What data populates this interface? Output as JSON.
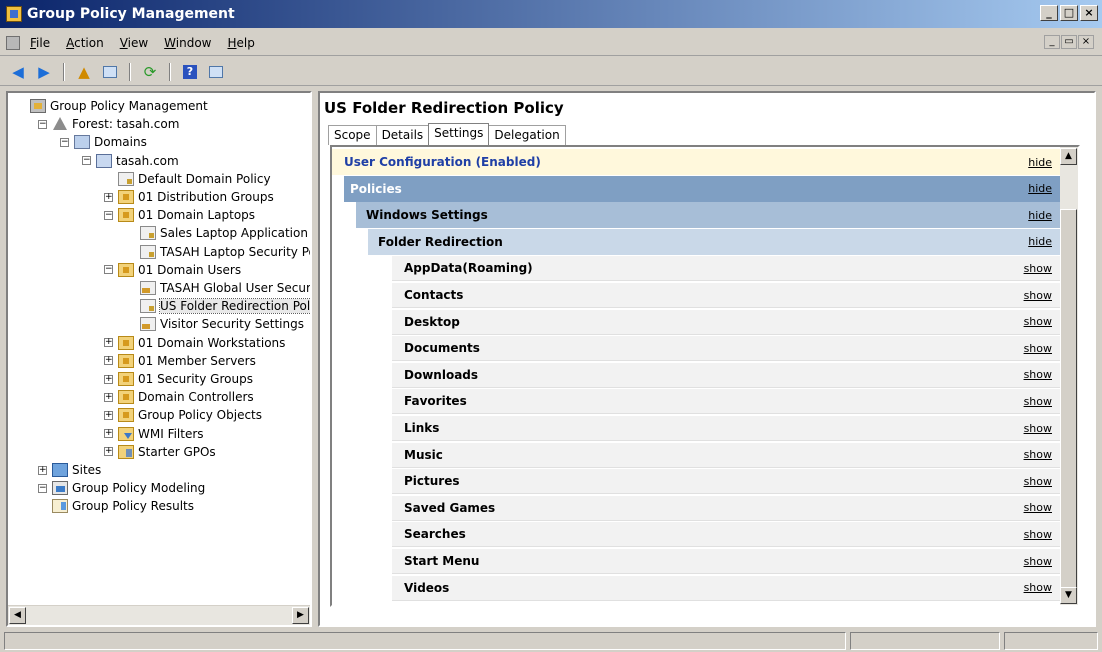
{
  "window": {
    "title": "Group Policy Management"
  },
  "menu": {
    "items": [
      "File",
      "Action",
      "View",
      "Window",
      "Help"
    ]
  },
  "toolbar": {
    "buttons": [
      "back-icon",
      "forward-icon",
      "up-folder-icon",
      "show-hide-tree-icon",
      "refresh-icon",
      "help-icon",
      "properties-icon"
    ]
  },
  "tree": {
    "nodes": [
      {
        "label": "Group Policy Management",
        "icon": "gpm-icon",
        "depth": 0,
        "expander": ""
      },
      {
        "label": "Forest: tasah.com",
        "icon": "forest-icon",
        "depth": 1,
        "expander": "−"
      },
      {
        "label": "Domains",
        "icon": "domains-icon",
        "depth": 2,
        "expander": "−"
      },
      {
        "label": "tasah.com",
        "icon": "domain-icon",
        "depth": 3,
        "expander": "−"
      },
      {
        "label": "Default Domain Policy",
        "icon": "gpo-link-icon",
        "depth": 4,
        "expander": ""
      },
      {
        "label": "01 Distribution Groups",
        "icon": "ou-icon",
        "depth": 4,
        "expander": "+"
      },
      {
        "label": "01 Domain Laptops",
        "icon": "ou-icon",
        "depth": 4,
        "expander": "−"
      },
      {
        "label": "Sales Laptop Application Suite",
        "icon": "gpo-link-icon",
        "depth": 5,
        "expander": ""
      },
      {
        "label": "TASAH Laptop Security Policy",
        "icon": "gpo-link-icon",
        "depth": 5,
        "expander": ""
      },
      {
        "label": "01 Domain Users",
        "icon": "ou-icon",
        "depth": 4,
        "expander": "−"
      },
      {
        "label": "TASAH Global User Security P",
        "icon": "gpo-mixed-icon",
        "depth": 5,
        "expander": ""
      },
      {
        "label": "US Folder Redirection Policy",
        "icon": "gpo-link-icon",
        "depth": 5,
        "expander": "",
        "selected": true
      },
      {
        "label": "Visitor Security Settings",
        "icon": "gpo-mixed-icon",
        "depth": 5,
        "expander": ""
      },
      {
        "label": "01 Domain Workstations",
        "icon": "ou-icon",
        "depth": 4,
        "expander": "+"
      },
      {
        "label": "01 Member Servers",
        "icon": "ou-icon",
        "depth": 4,
        "expander": "+"
      },
      {
        "label": "01 Security Groups",
        "icon": "ou-icon",
        "depth": 4,
        "expander": "+"
      },
      {
        "label": "Domain Controllers",
        "icon": "ou-icon",
        "depth": 4,
        "expander": "+"
      },
      {
        "label": "Group Policy Objects",
        "icon": "gpo-folder-icon",
        "depth": 4,
        "expander": "+"
      },
      {
        "label": "WMI Filters",
        "icon": "wmi-filter-icon",
        "depth": 4,
        "expander": "+"
      },
      {
        "label": "Starter GPOs",
        "icon": "starter-gpo-icon",
        "depth": 4,
        "expander": "+"
      },
      {
        "label": "Sites",
        "icon": "sites-icon",
        "depth": 1,
        "expander": "+"
      },
      {
        "label": "Group Policy Modeling",
        "icon": "modeling-icon",
        "depth": 1,
        "expander": "−"
      },
      {
        "label": "Group Policy Results",
        "icon": "results-icon",
        "depth": 1,
        "expander": ""
      }
    ]
  },
  "details": {
    "title": "US Folder Redirection Policy",
    "tabs": [
      {
        "label": "Scope",
        "active": false
      },
      {
        "label": "Details",
        "active": false
      },
      {
        "label": "Settings",
        "active": true
      },
      {
        "label": "Delegation",
        "active": false
      }
    ],
    "sections": [
      {
        "label": "User Configuration (Enabled)",
        "toggle": "hide",
        "level": 0
      },
      {
        "label": "Policies",
        "toggle": "hide",
        "level": 1
      },
      {
        "label": "Windows Settings",
        "toggle": "hide",
        "level": 2
      },
      {
        "label": "Folder Redirection",
        "toggle": "hide",
        "level": 3
      }
    ],
    "items": [
      {
        "label": "AppData(Roaming)",
        "toggle": "show"
      },
      {
        "label": "Contacts",
        "toggle": "show"
      },
      {
        "label": "Desktop",
        "toggle": "show"
      },
      {
        "label": "Documents",
        "toggle": "show"
      },
      {
        "label": "Downloads",
        "toggle": "show"
      },
      {
        "label": "Favorites",
        "toggle": "show"
      },
      {
        "label": "Links",
        "toggle": "show"
      },
      {
        "label": "Music",
        "toggle": "show"
      },
      {
        "label": "Pictures",
        "toggle": "show"
      },
      {
        "label": "Saved Games",
        "toggle": "show"
      },
      {
        "label": "Searches",
        "toggle": "show"
      },
      {
        "label": "Start Menu",
        "toggle": "show"
      },
      {
        "label": "Videos",
        "toggle": "show"
      }
    ]
  }
}
